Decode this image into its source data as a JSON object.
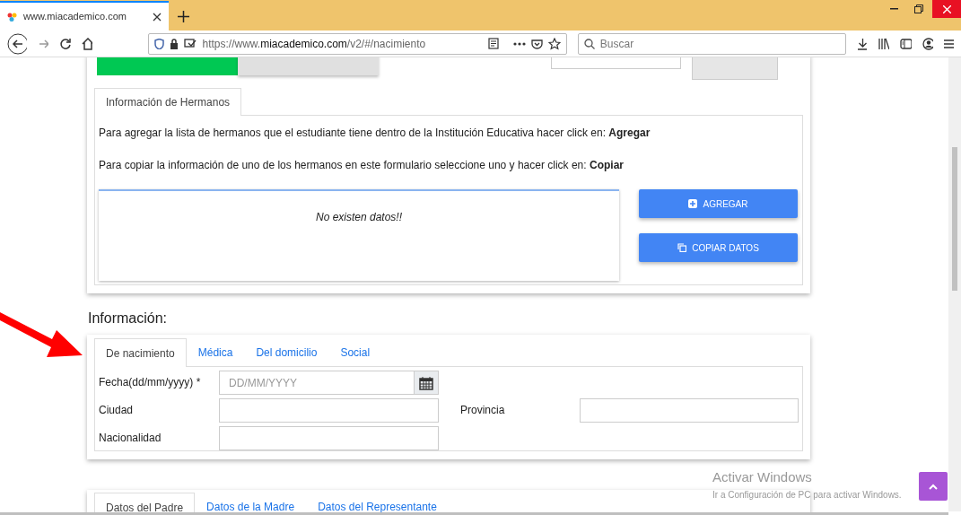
{
  "browser": {
    "tab_title": "www.miacademico.com",
    "url_prefix": "https://www.",
    "url_domain": "miacademico.com",
    "url_path": "/v2/#/nacimiento",
    "search_placeholder": "Buscar"
  },
  "gender_buttons": [
    {
      "selected": true
    },
    {
      "selected": false
    }
  ],
  "siblings": {
    "tabs": [
      {
        "label": "Información de Hermanos",
        "selected": true
      }
    ],
    "instructions": [
      "Para agregar la lista de hermanos que el estudiante tiene dentro de la Institución Educativa hacer click en: **Agregar**",
      "Para copiar la información de uno de los hermanos en este formulario seleccione uno y hacer click en: **Copiar**"
    ],
    "empty_message": "No existen datos!!",
    "buttons": [
      {
        "kind": "add",
        "label": "AGREGAR"
      },
      {
        "kind": "copy",
        "label": "COPIAR DATOS"
      }
    ]
  },
  "info": {
    "heading": "Información:",
    "tabs": [
      {
        "label": "De nacimiento",
        "selected": true
      },
      {
        "label": "Médica",
        "selected": false
      },
      {
        "label": "Del domicilio",
        "selected": false
      },
      {
        "label": "Social",
        "selected": false
      }
    ],
    "fields": [
      {
        "kind": "date",
        "label": "Fecha(dd/mm/yyyy) *",
        "placeholder": "DD/MM/YYYY"
      },
      {
        "kind": "text",
        "label": "Ciudad"
      },
      {
        "kind": "text",
        "label": "Provincia"
      },
      {
        "kind": "text",
        "label": "Nacionalidad"
      }
    ]
  },
  "parents": {
    "tabs": [
      {
        "label": "Datos del Padre",
        "selected": true
      },
      {
        "label": "Datos de la Madre",
        "selected": false
      },
      {
        "label": "Datos del Representante",
        "selected": false
      }
    ]
  },
  "windows_notice": {
    "title": "Activar Windows",
    "subtitle": "Ir a Configuración de PC para activar Windows."
  }
}
